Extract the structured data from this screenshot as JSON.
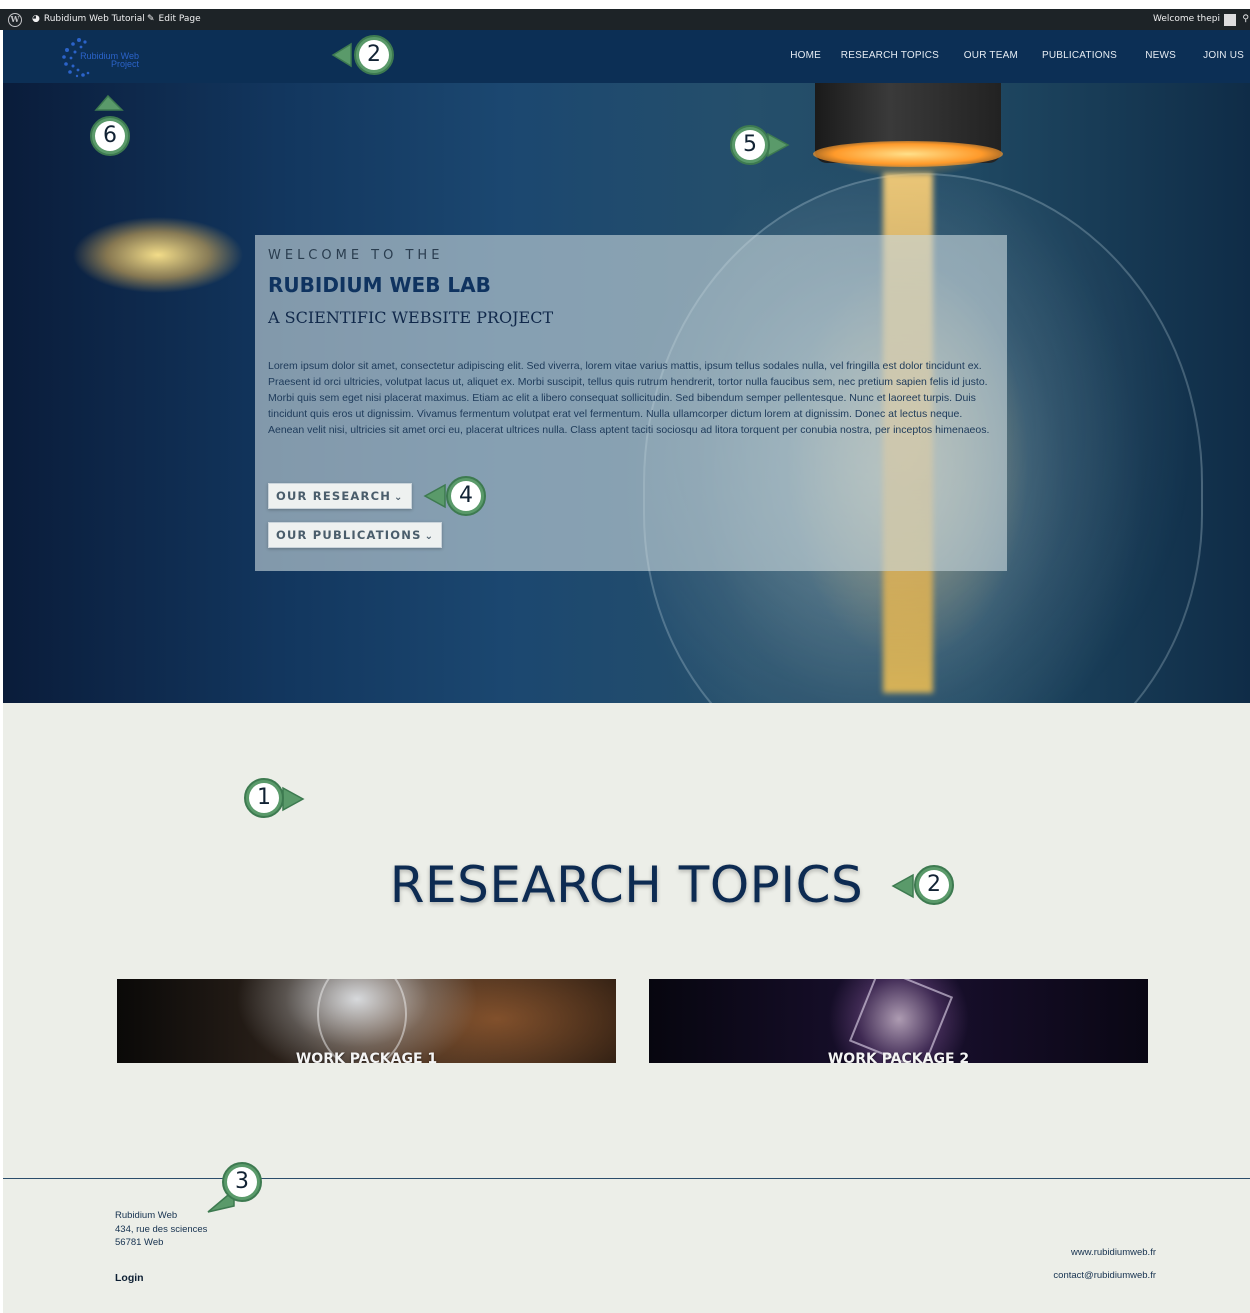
{
  "admin_bar": {
    "site_name": "Rubidium Web Tutorial",
    "edit_label": "Edit Page",
    "welcome": "Welcome thepi"
  },
  "header": {
    "logo_text": "Rubidium Web Project",
    "nav": [
      "HOME",
      "RESEARCH TOPICS",
      "OUR TEAM",
      "PUBLICATIONS",
      "NEWS",
      "JOIN US"
    ]
  },
  "hero": {
    "kicker": "WELCOME TO THE",
    "title": "RUBIDIUM WEB LAB",
    "subtitle": "A SCIENTIFIC WEBSITE PROJECT",
    "body": "Lorem ipsum dolor sit amet, consectetur adipiscing elit. Sed viverra, lorem vitae varius mattis, ipsum tellus sodales nulla, vel fringilla est dolor tincidunt ex. Praesent id orci ultricies, volutpat lacus ut, aliquet ex. Morbi suscipit, tellus quis rutrum hendrerit, tortor nulla faucibus sem, nec pretium sapien felis id justo. Morbi quis sem eget nisi placerat maximus. Etiam ac elit a libero consequat sollicitudin. Sed bibendum semper pellentesque. Nunc et laoreet turpis. Duis tincidunt quis eros ut dignissim. Vivamus fermentum volutpat erat vel fermentum. Nulla ullamcorper dictum lorem at dignissim. Donec at lectus neque. Aenean velit nisi, ultricies sit amet orci eu, placerat ultrices nulla. Class aptent taciti sociosqu ad litora torquent per conubia nostra, per inceptos himenaeos.",
    "button_research": "OUR RESEARCH",
    "button_publications": "OUR PUBLICATIONS"
  },
  "main": {
    "section_title": "RESEARCH TOPICS",
    "cards": [
      "WORK PACKAGE 1",
      "WORK PACKAGE 2"
    ]
  },
  "footer": {
    "address": [
      "Rubidium Web",
      "434, rue des sciences",
      "56781 Web"
    ],
    "login": "Login",
    "website": "www.rubidiumweb.fr",
    "email": "contact@rubidiumweb.fr"
  },
  "callouts": [
    "1",
    "2",
    "3",
    "4",
    "5",
    "6",
    "2"
  ]
}
